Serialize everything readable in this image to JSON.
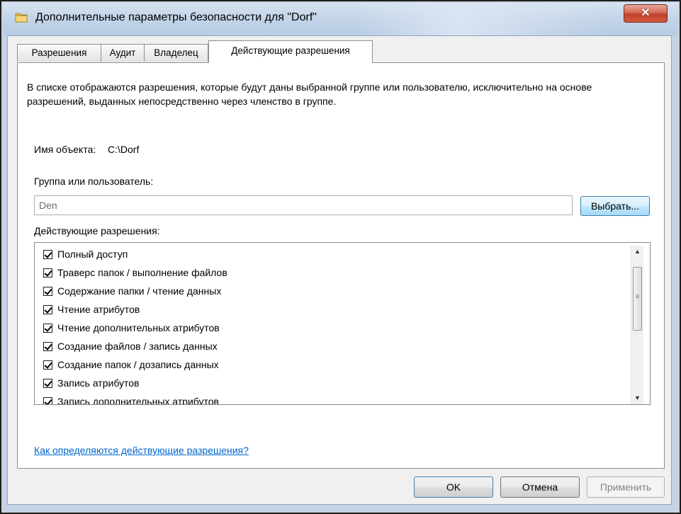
{
  "window": {
    "title": "Дополнительные параметры безопасности  для \"Dorf\"",
    "close_label": "✕"
  },
  "tabs": [
    {
      "label": "Разрешения"
    },
    {
      "label": "Аудит"
    },
    {
      "label": "Владелец"
    },
    {
      "label": "Действующие разрешения"
    }
  ],
  "panel": {
    "description": "В списке отображаются разрешения, которые будут даны выбранной группе или пользователю, исключительно на основе разрешений, выданных непосредственно через членство в группе.",
    "object_name_label": "Имя объекта:",
    "object_name_value": "C:\\Dorf",
    "group_label": "Группа или пользователь:",
    "user_value": "Den",
    "select_button": "Выбрать...",
    "effective_label": "Действующие разрешения:",
    "permissions": [
      {
        "label": "Полный доступ",
        "checked": true
      },
      {
        "label": "Траверс папок / выполнение файлов",
        "checked": true
      },
      {
        "label": "Содержание папки / чтение данных",
        "checked": true
      },
      {
        "label": "Чтение атрибутов",
        "checked": true
      },
      {
        "label": "Чтение дополнительных атрибутов",
        "checked": true
      },
      {
        "label": "Создание файлов / запись данных",
        "checked": true
      },
      {
        "label": "Создание папок / дозапись данных",
        "checked": true
      },
      {
        "label": "Запись атрибутов",
        "checked": true
      },
      {
        "label": "Запись дополнительных атрибутов",
        "checked": true
      }
    ],
    "help_link": "Как определяются действующие разрешения?"
  },
  "buttons": {
    "ok": "OK",
    "cancel": "Отмена",
    "apply": "Применить"
  },
  "icons": {
    "folder": "folder-icon",
    "close": "close-icon",
    "checkbox": "checkbox-checked-icon"
  }
}
